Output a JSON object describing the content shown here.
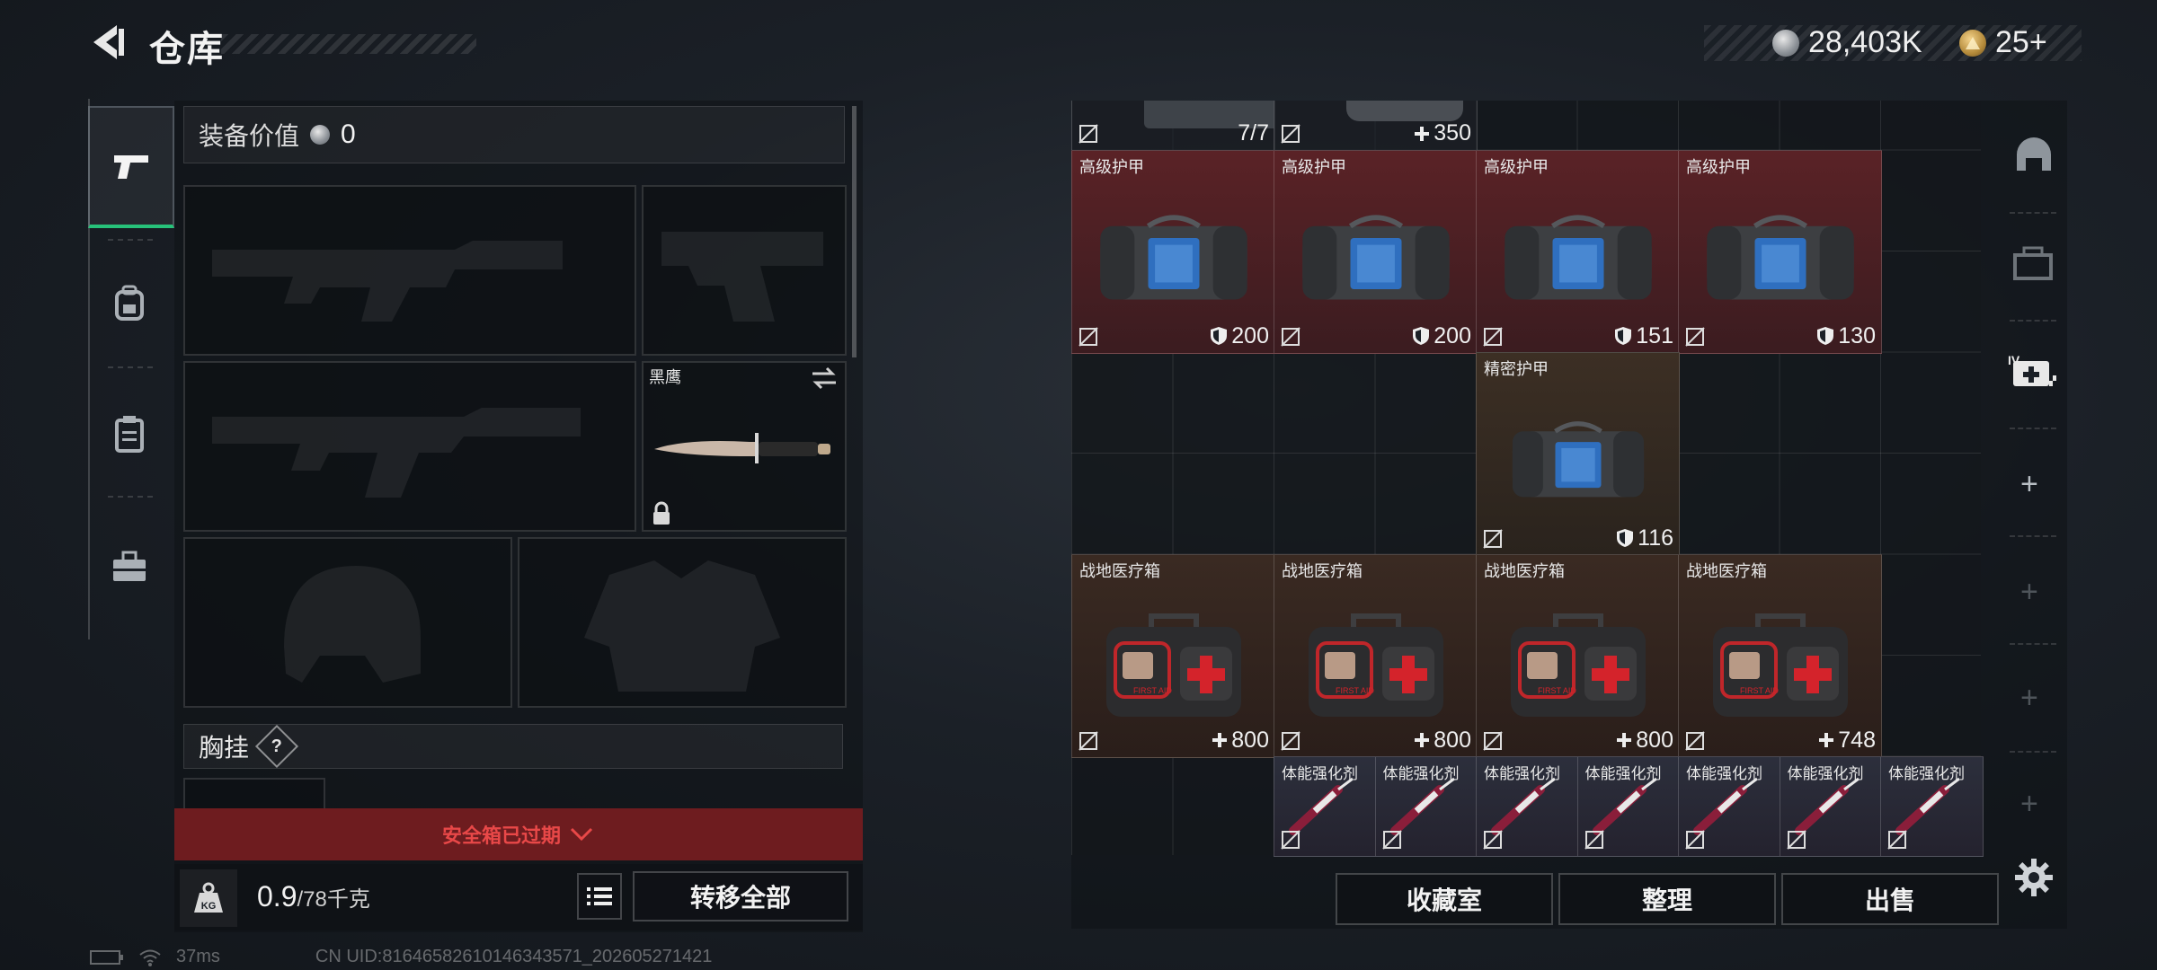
{
  "header": {
    "title": "仓库"
  },
  "currency": [
    {
      "icon": "silver-coin-icon",
      "value": "28,403K"
    },
    {
      "icon": "gold-triangle-coin-icon",
      "value": "25+"
    }
  ],
  "nav": [
    {
      "icon": "pistol-icon",
      "active": true
    },
    {
      "icon": "backpack-icon",
      "active": false
    },
    {
      "icon": "clipboard-icon",
      "active": false
    },
    {
      "icon": "toolbox-icon",
      "active": false
    }
  ],
  "loadout": {
    "value_label": "装备价值",
    "value": "0",
    "knife_name": "黑鹰",
    "chest_rig_label": "胸挂",
    "chest_rig_help": "?",
    "safe_box_expired": "安全箱已过期",
    "weight_current": "0.9",
    "weight_max": "/78千克",
    "weight_icon_text": "KG",
    "transfer_all": "转移全部"
  },
  "storage": {
    "top_row": [
      {
        "value": "7/7"
      },
      {
        "value": "350"
      }
    ],
    "armor": [
      {
        "name": "高级护甲",
        "value": "200"
      },
      {
        "name": "高级护甲",
        "value": "200"
      },
      {
        "name": "高级护甲",
        "value": "151"
      },
      {
        "name": "高级护甲",
        "value": "130"
      }
    ],
    "precision_armor": {
      "name": "精密护甲",
      "value": "116"
    },
    "medkits": [
      {
        "name": "战地医疗箱",
        "value": "800"
      },
      {
        "name": "战地医疗箱",
        "value": "800"
      },
      {
        "name": "战地医疗箱",
        "value": "800"
      },
      {
        "name": "战地医疗箱",
        "value": "748"
      }
    ],
    "stims": [
      {
        "name": "体能强化剂"
      },
      {
        "name": "体能强化剂"
      },
      {
        "name": "体能强化剂"
      },
      {
        "name": "体能强化剂"
      },
      {
        "name": "体能强化剂"
      },
      {
        "name": "体能强化剂"
      },
      {
        "name": "体能强化剂"
      }
    ],
    "medkit_print": "FIRST AID"
  },
  "bottom_buttons": {
    "collection": "收藏室",
    "organize": "整理",
    "sell": "出售"
  },
  "side_tools": [
    "helmet-icon",
    "case-icon",
    "add-medkit-icon",
    "plus-icon",
    "plus-icon",
    "plus-icon",
    "plus-icon"
  ],
  "side_tools_label": "IV",
  "status": {
    "ping": "37ms",
    "uid": "CN UID:81646582610146343571_202605271421"
  },
  "colors": {
    "armor_bg": "#5a2226",
    "precision_bg": "#3c2f24",
    "medkit_bg": "#3a2a22",
    "stim_bg": "#2c2f3c",
    "active_green": "#27c27a",
    "expired_red": "#e84848"
  }
}
